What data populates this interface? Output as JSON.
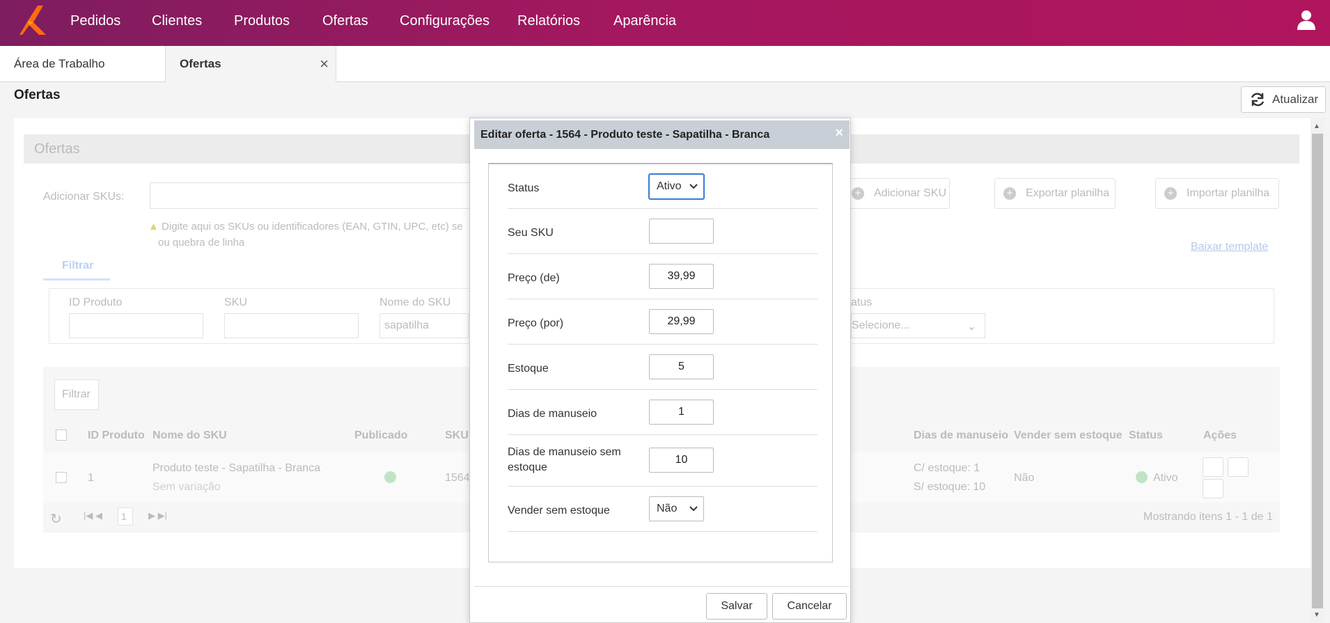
{
  "nav": {
    "items": [
      "Pedidos",
      "Clientes",
      "Produtos",
      "Ofertas",
      "Configurações",
      "Relatórios",
      "Aparência"
    ]
  },
  "tabs": {
    "desktop": "Área de Trabalho",
    "active": "Ofertas"
  },
  "page": {
    "title": "Ofertas",
    "refresh_label": "Atualizar"
  },
  "background": {
    "panel_title": "Ofertas",
    "add_skus_label": "Adicionar SKUs:",
    "hint_line1": "Digite aqui os SKUs ou identificadores (EAN, GTIN, UPC, etc) se",
    "hint_line2": "ou quebra de linha",
    "add_sku_button": "Adicionar SKU",
    "export_button": "Exportar planilha",
    "import_button": "Importar planilha",
    "download_template": "Baixar template",
    "filter_tab": "Filtrar",
    "filters": {
      "id_produto": "ID Produto",
      "sku": "SKU",
      "nome_sku": "Nome do SKU",
      "nome_sku_value": "sapatilha",
      "status": "atus",
      "status_placeholder": "Selecione..."
    },
    "filter_button": "Filtrar",
    "columns": {
      "id_produto": "ID Produto",
      "nome_sku": "Nome do SKU",
      "publicado": "Publicado",
      "sku": "SKU",
      "dias_manuseio": "Dias de manuseio",
      "vender_sem_estoque": "Vender sem estoque",
      "status": "Status",
      "acoes": "Ações"
    },
    "row": {
      "id": "1",
      "nome": "Produto teste - Sapatilha - Branca",
      "variacao": "Sem variação",
      "sku": "1564",
      "dias_com": "C/ estoque: 1",
      "dias_sem": "S/ estoque: 10",
      "vender": "Não",
      "status": "Ativo"
    },
    "pager_page": "1",
    "pager_info": "Mostrando itens 1 - 1 de 1"
  },
  "modal": {
    "title": "Editar oferta - 1564 - Produto teste - Sapatilha - Branca",
    "fields": {
      "status_label": "Status",
      "status_value": "Ativo",
      "sku_label": "Seu SKU",
      "sku_value": "",
      "preco_de_label": "Preço (de)",
      "preco_de_value": "39,99",
      "preco_por_label": "Preço (por)",
      "preco_por_value": "29,99",
      "estoque_label": "Estoque",
      "estoque_value": "5",
      "dias_label": "Dias de manuseio",
      "dias_value": "1",
      "dias_sem_label_1": "Dias de manuseio sem",
      "dias_sem_label_2": "estoque",
      "dias_sem_value": "10",
      "vender_label": "Vender sem estoque",
      "vender_value": "Não"
    },
    "save_label": "Salvar",
    "cancel_label": "Cancelar"
  },
  "colors": {
    "nav_start": "#7d1d5f",
    "nav_end": "#b0155e",
    "modal_header": "#c9cfd6",
    "focus": "#3a7bd5"
  }
}
